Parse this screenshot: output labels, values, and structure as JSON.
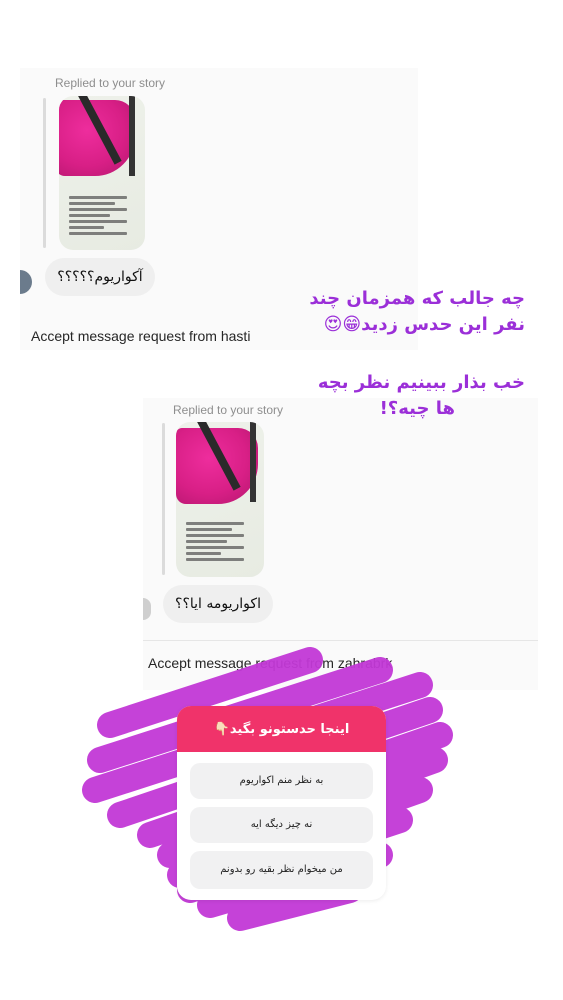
{
  "thread1": {
    "replied_label": "Replied to your story",
    "reply_text": "آکواریوم؟؟؟؟؟",
    "accept_text": "Accept message request from hasti"
  },
  "thread2": {
    "replied_label": "Replied to your story",
    "reply_text": "اکواریومه ایا؟؟",
    "accept_text": "Accept message request from zahrabrk"
  },
  "caption": {
    "line1": "چه جالب که همزمان چند",
    "line2": "نفر این حدس زدید😁😍",
    "line3": "خب بذار ببینیم نظر بچه",
    "line4": "ها چیه؟!"
  },
  "poll": {
    "question": "اینجا حدستونو بگید👇🏻",
    "options": [
      "به نظر منم اکواریوم",
      "نه چیز دیگه ایه",
      "من میخوام نظر بقیه رو بدونم"
    ]
  },
  "colors": {
    "caption_purple": "#9b2fd8",
    "scribble_magenta": "#c238d6",
    "poll_header": "#f0336a"
  }
}
